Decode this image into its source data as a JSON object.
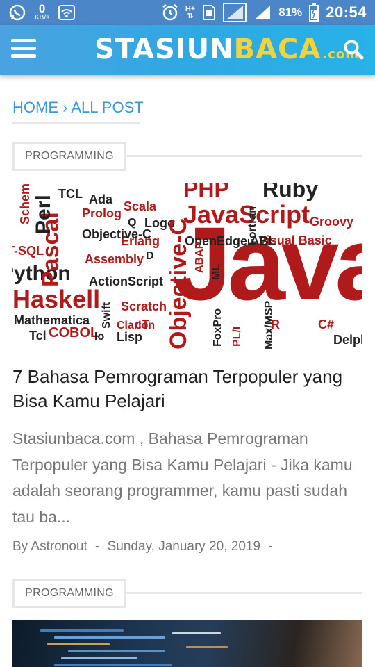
{
  "status_bar": {
    "speed_value": "0",
    "speed_unit": "KB/s",
    "network_type": "H+",
    "battery_percent": "81%",
    "time": "20:54",
    "icons": [
      "whatsapp-icon",
      "wifi-icon",
      "alarm-icon",
      "sim-icon",
      "signal-icon",
      "battery-icon"
    ]
  },
  "header": {
    "logo_part1": "STASIUN",
    "logo_part2": "BACA",
    "logo_part3": ".com",
    "menu_icon": "hamburger-menu-icon",
    "search_icon": "search-icon",
    "colors": {
      "bar": "#2fa8e3",
      "logo_white": "#ffffff",
      "logo_yellow": "#f3d33a"
    }
  },
  "breadcrumb": {
    "home": "HOME",
    "separator": "›",
    "current": "ALL POST"
  },
  "posts": [
    {
      "category": "PROGRAMMING",
      "image_words": [
        "PHP",
        "Ruby",
        "JavaScript",
        "Java",
        "Perl",
        "Pascal",
        "Haskell",
        "Objective-C",
        "Scala",
        "Prolog",
        "Logo",
        "Erlang",
        "OpenEdge ABL",
        "Visual Basic",
        "Groovy",
        "Assembly",
        "ActionScript",
        "Scratch",
        "Swift",
        "Mathematica",
        "COBOL",
        "Lisp",
        "Tcl",
        "Io",
        "cT",
        "Clarion",
        "C#",
        "Delphi",
        "FoxPro",
        "PL/I",
        "ML",
        "ABAP",
        "Fortran",
        "Max/MSP",
        "TCL",
        "Ada",
        "Q",
        "D",
        "R",
        "Scheme",
        "T-SQL",
        "Python"
      ],
      "title": "7 Bahasa Pemrograman Terpopuler yang Bisa Kamu Pelajari",
      "excerpt": "Stasiunbaca.com ,  Bahasa Pemrograman Terpopuler yang Bisa Kamu Pelajari  - Jika kamu adalah seorang programmer, kamu pasti sudah tau ba...",
      "author": "By Astronout",
      "date": "Sunday, January 20, 2019"
    },
    {
      "category": "PROGRAMMING"
    }
  ],
  "meta_separator": "-"
}
